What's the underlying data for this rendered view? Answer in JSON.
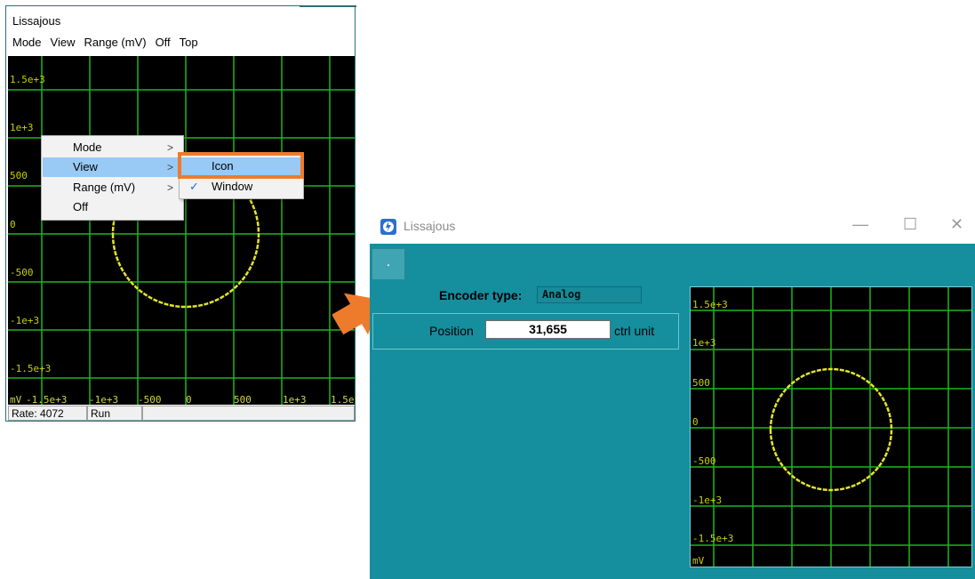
{
  "left_window": {
    "title": "Lissajous",
    "menu": [
      "Mode",
      "View",
      "Range (mV)",
      "Off",
      "Top"
    ],
    "plot": {
      "y_labels": [
        "1.5e+3",
        "1e+3",
        "500",
        "0",
        "-500",
        "-1e+3",
        "-1.5e+3"
      ],
      "x_labels": [
        "mV",
        "-1.5e+3",
        "-1e+3",
        "-500",
        "0",
        "500",
        "1e+3",
        "1.5e"
      ]
    },
    "status": [
      "Rate: 4072",
      "Run",
      ""
    ],
    "context_menu": [
      {
        "label": "Mode",
        "arrow": ">"
      },
      {
        "label": "View",
        "arrow": ">"
      },
      {
        "label": "Range (mV)",
        "arrow": ">"
      },
      {
        "label": "Off",
        "arrow": ""
      }
    ],
    "submenu": [
      {
        "label": "Icon",
        "check": ""
      },
      {
        "label": "Window",
        "check": "✓"
      }
    ]
  },
  "right_window": {
    "title": "Lissajous",
    "controls": {
      "minimize": "—",
      "maximize": "☐",
      "close": "✕"
    },
    "toolbar_button": ".",
    "encoder_type_label": "Encoder type:",
    "encoder_type_value": "Analog",
    "position_label": "Position",
    "position_value": "31,655",
    "position_unit": "ctrl unit",
    "plot": {
      "y_labels": [
        "1.5e+3",
        "1e+3",
        "500",
        "0",
        "-500",
        "-1e+3",
        "-1.5e+3",
        "mV"
      ]
    }
  },
  "colors": {
    "grid": "#1fb51f",
    "trace": "#e4e42e",
    "teal_bg": "#158e9e",
    "highlight": "#ee7b2b",
    "arrow": "#ee7b2b"
  }
}
